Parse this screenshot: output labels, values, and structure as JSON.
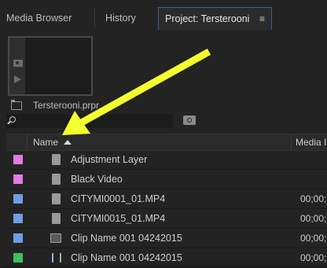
{
  "tabs": [
    {
      "label": "Media Browser"
    },
    {
      "label": "History"
    },
    {
      "label": "Project: Tersterooni"
    }
  ],
  "active_tab_menu": "≡",
  "project": {
    "name": "Tersterooni.prpr"
  },
  "search": {
    "value": "",
    "placeholder": ""
  },
  "columns": {
    "name": "Name",
    "media": "Media I"
  },
  "items": [
    {
      "label": "Adjustment Layer",
      "color": "#e37ae3",
      "icon": "adjustment-layer-icon",
      "media": ""
    },
    {
      "label": "Black Video",
      "color": "#e37ae3",
      "icon": "black-video-icon",
      "media": ""
    },
    {
      "label": "CITYMI0001_01.MP4",
      "color": "#6f9de2",
      "icon": "video-file-icon",
      "media": "00;00;"
    },
    {
      "label": "CITYMI0015_01.MP4",
      "color": "#6f9de2",
      "icon": "video-file-icon",
      "media": "00;00;"
    },
    {
      "label": "Clip Name  001  04242015",
      "color": "#6f9de2",
      "icon": "sequence-icon",
      "media": "00;00;"
    },
    {
      "label": "Clip Name  001  04242015",
      "color": "#3fbf5f",
      "icon": "multicam-icon",
      "media": "00;00;"
    }
  ],
  "colors": {
    "annotation_arrow": "#f3ff2e",
    "active_tab_border": "#3b5f8a"
  }
}
